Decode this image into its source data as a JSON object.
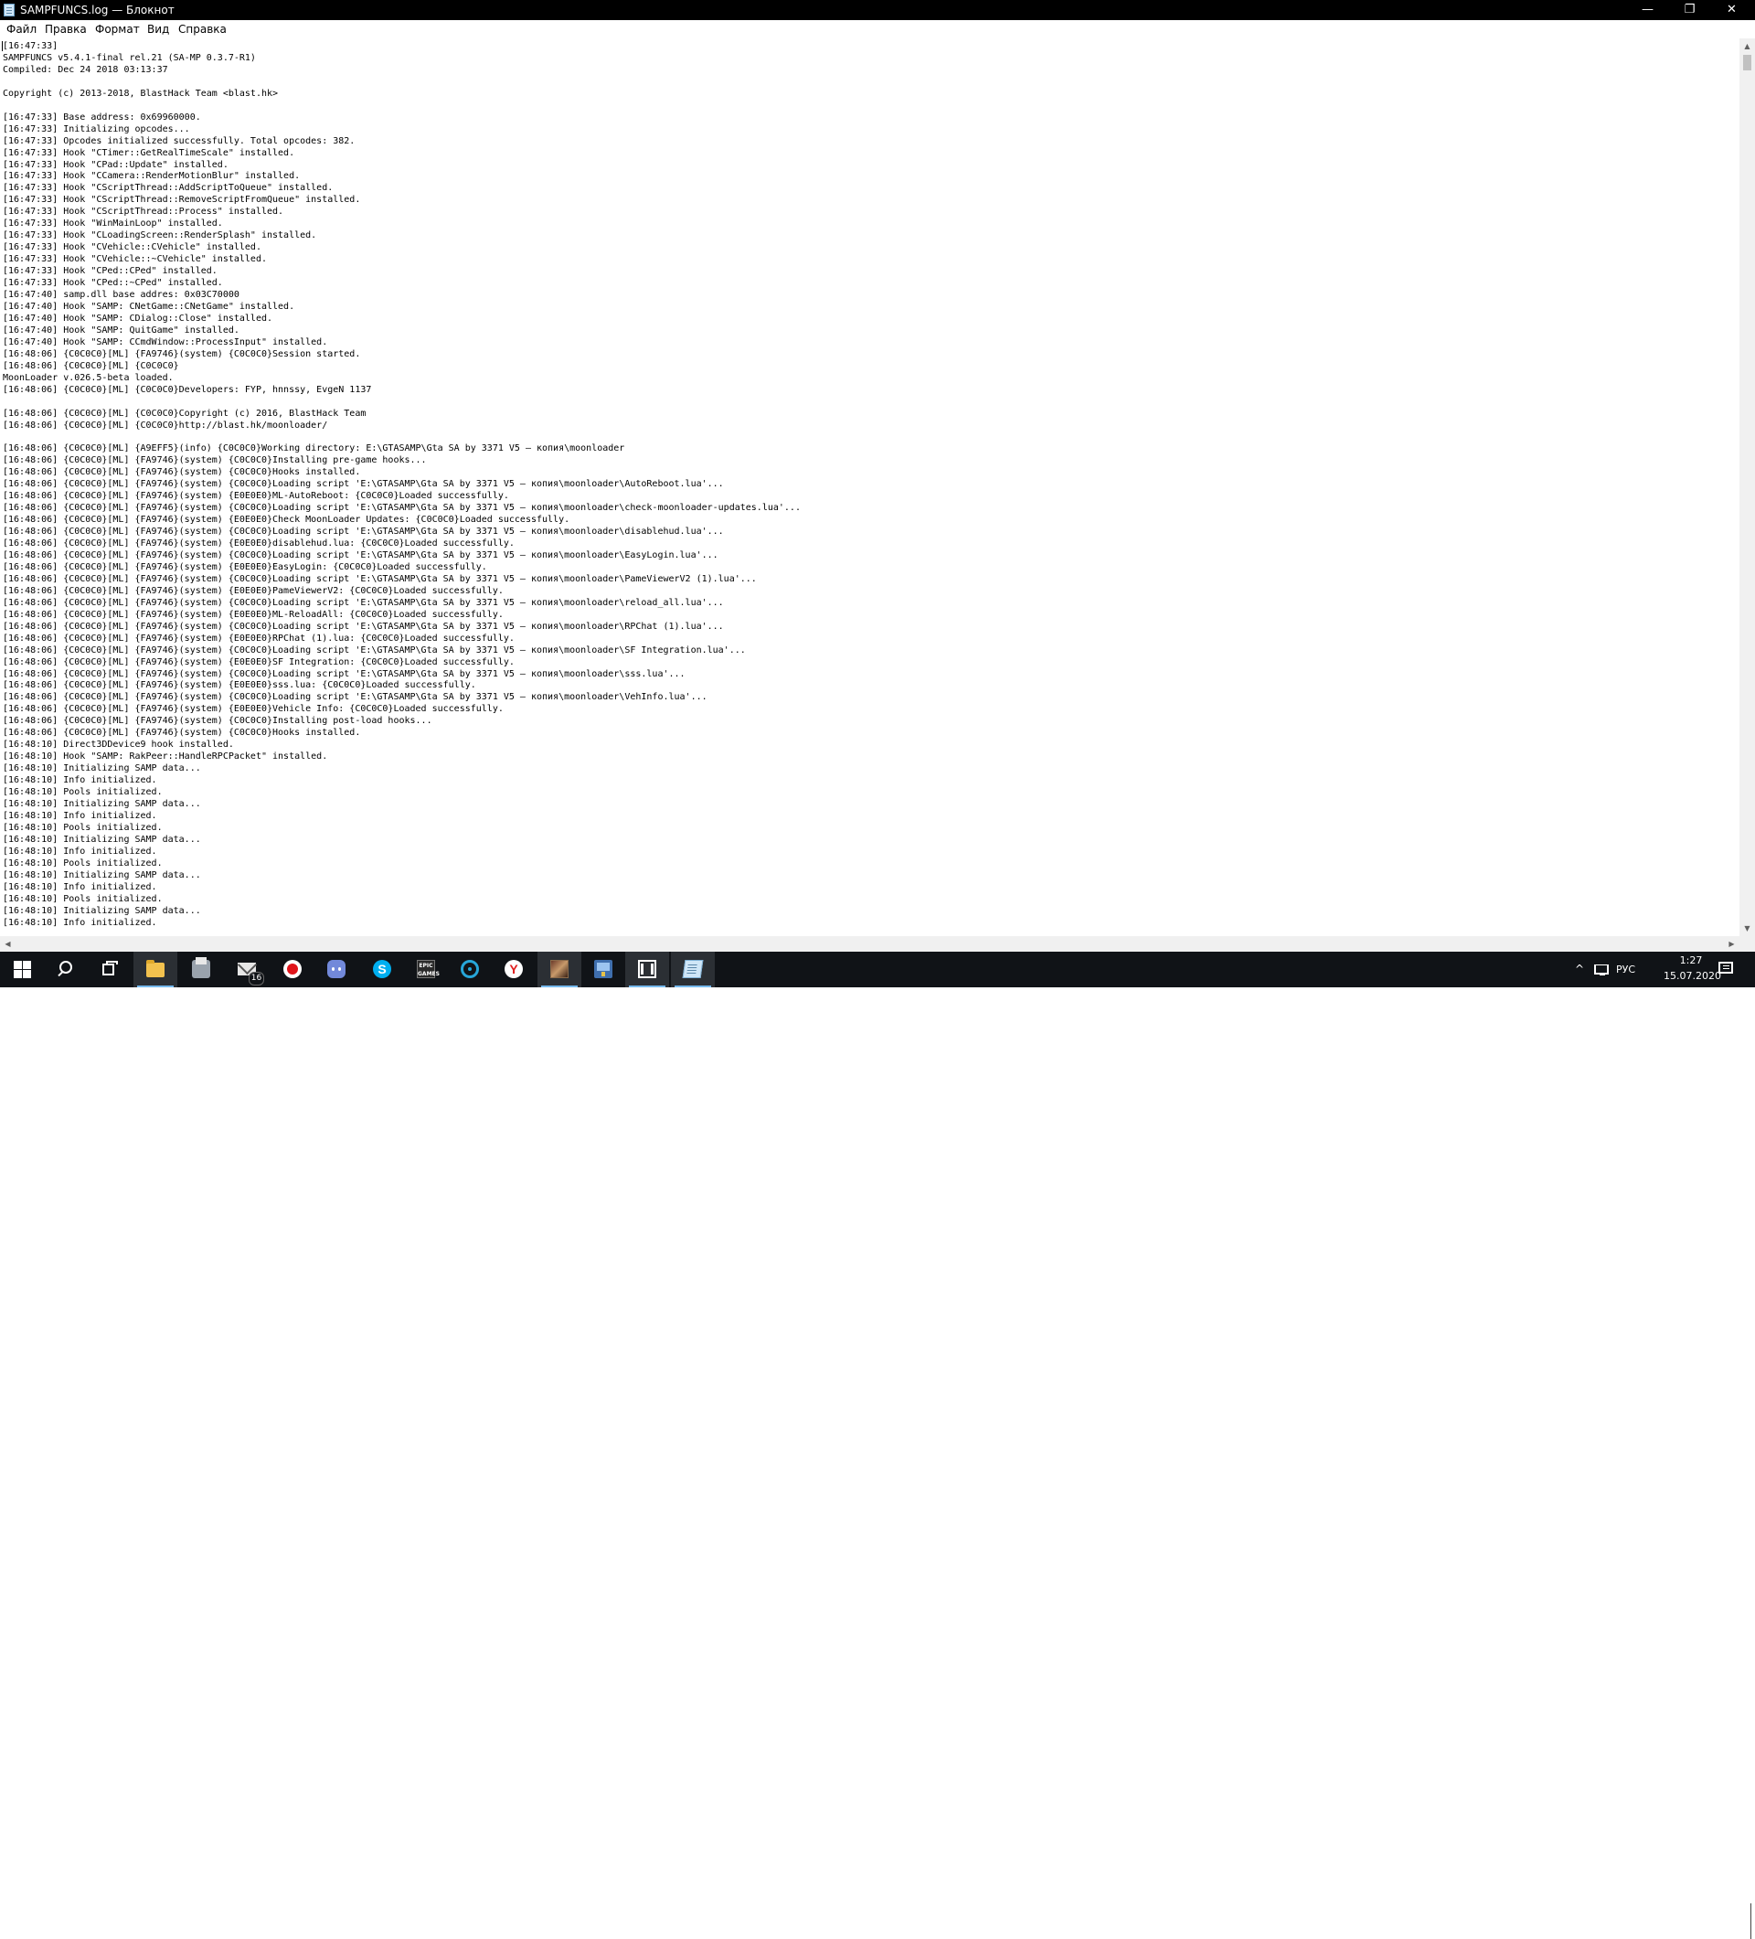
{
  "window": {
    "title": "SAMPFUNCS.log — Блокнот",
    "min_glyph": "—",
    "max_glyph": "❐",
    "close_glyph": "✕"
  },
  "menu": {
    "file": "Файл",
    "edit": "Правка",
    "format": "Формат",
    "view": "Вид",
    "help": "Справка"
  },
  "scrollbar": {
    "up": "▲",
    "down": "▼",
    "left": "◀",
    "right": "▶"
  },
  "log_text": "[16:47:33]\nSAMPFUNCS v5.4.1-final rel.21 (SA-MP 0.3.7-R1)\nCompiled: Dec 24 2018 03:13:37\n\nCopyright (c) 2013-2018, BlastHack Team <blast.hk>\n\n[16:47:33] Base address: 0x69960000.\n[16:47:33] Initializing opcodes...\n[16:47:33] Opcodes initialized successfully. Total opcodes: 382.\n[16:47:33] Hook \"CTimer::GetRealTimeScale\" installed.\n[16:47:33] Hook \"CPad::Update\" installed.\n[16:47:33] Hook \"CCamera::RenderMotionBlur\" installed.\n[16:47:33] Hook \"CScriptThread::AddScriptToQueue\" installed.\n[16:47:33] Hook \"CScriptThread::RemoveScriptFromQueue\" installed.\n[16:47:33] Hook \"CScriptThread::Process\" installed.\n[16:47:33] Hook \"WinMainLoop\" installed.\n[16:47:33] Hook \"CLoadingScreen::RenderSplash\" installed.\n[16:47:33] Hook \"CVehicle::CVehicle\" installed.\n[16:47:33] Hook \"CVehicle::~CVehicle\" installed.\n[16:47:33] Hook \"CPed::CPed\" installed.\n[16:47:33] Hook \"CPed::~CPed\" installed.\n[16:47:40] samp.dll base addres: 0x03C70000\n[16:47:40] Hook \"SAMP: CNetGame::CNetGame\" installed.\n[16:47:40] Hook \"SAMP: CDialog::Close\" installed.\n[16:47:40] Hook \"SAMP: QuitGame\" installed.\n[16:47:40] Hook \"SAMP: CCmdWindow::ProcessInput\" installed.\n[16:48:06] {C0C0C0}[ML] {FA9746}(system) {C0C0C0}Session started.\n[16:48:06] {C0C0C0}[ML] {C0C0C0}\nMoonLoader v.026.5-beta loaded.\n[16:48:06] {C0C0C0}[ML] {C0C0C0}Developers: FYP, hnnssy, EvgeN 1137\n\n[16:48:06] {C0C0C0}[ML] {C0C0C0}Copyright (c) 2016, BlastHack Team\n[16:48:06] {C0C0C0}[ML] {C0C0C0}http://blast.hk/moonloader/\n\n[16:48:06] {C0C0C0}[ML] {A9EFF5}(info) {C0C0C0}Working directory: E:\\GTASAMP\\Gta SA by 3371 V5 — копия\\moonloader\n[16:48:06] {C0C0C0}[ML] {FA9746}(system) {C0C0C0}Installing pre-game hooks...\n[16:48:06] {C0C0C0}[ML] {FA9746}(system) {C0C0C0}Hooks installed.\n[16:48:06] {C0C0C0}[ML] {FA9746}(system) {C0C0C0}Loading script 'E:\\GTASAMP\\Gta SA by 3371 V5 — копия\\moonloader\\AutoReboot.lua'...\n[16:48:06] {C0C0C0}[ML] {FA9746}(system) {E0E0E0}ML-AutoReboot: {C0C0C0}Loaded successfully.\n[16:48:06] {C0C0C0}[ML] {FA9746}(system) {C0C0C0}Loading script 'E:\\GTASAMP\\Gta SA by 3371 V5 — копия\\moonloader\\check-moonloader-updates.lua'...\n[16:48:06] {C0C0C0}[ML] {FA9746}(system) {E0E0E0}Check MoonLoader Updates: {C0C0C0}Loaded successfully.\n[16:48:06] {C0C0C0}[ML] {FA9746}(system) {C0C0C0}Loading script 'E:\\GTASAMP\\Gta SA by 3371 V5 — копия\\moonloader\\disablehud.lua'...\n[16:48:06] {C0C0C0}[ML] {FA9746}(system) {E0E0E0}disablehud.lua: {C0C0C0}Loaded successfully.\n[16:48:06] {C0C0C0}[ML] {FA9746}(system) {C0C0C0}Loading script 'E:\\GTASAMP\\Gta SA by 3371 V5 — копия\\moonloader\\EasyLogin.lua'...\n[16:48:06] {C0C0C0}[ML] {FA9746}(system) {E0E0E0}EasyLogin: {C0C0C0}Loaded successfully.\n[16:48:06] {C0C0C0}[ML] {FA9746}(system) {C0C0C0}Loading script 'E:\\GTASAMP\\Gta SA by 3371 V5 — копия\\moonloader\\PameViewerV2 (1).lua'...\n[16:48:06] {C0C0C0}[ML] {FA9746}(system) {E0E0E0}PameViewerV2: {C0C0C0}Loaded successfully.\n[16:48:06] {C0C0C0}[ML] {FA9746}(system) {C0C0C0}Loading script 'E:\\GTASAMP\\Gta SA by 3371 V5 — копия\\moonloader\\reload_all.lua'...\n[16:48:06] {C0C0C0}[ML] {FA9746}(system) {E0E0E0}ML-ReloadAll: {C0C0C0}Loaded successfully.\n[16:48:06] {C0C0C0}[ML] {FA9746}(system) {C0C0C0}Loading script 'E:\\GTASAMP\\Gta SA by 3371 V5 — копия\\moonloader\\RPChat (1).lua'...\n[16:48:06] {C0C0C0}[ML] {FA9746}(system) {E0E0E0}RPChat (1).lua: {C0C0C0}Loaded successfully.\n[16:48:06] {C0C0C0}[ML] {FA9746}(system) {C0C0C0}Loading script 'E:\\GTASAMP\\Gta SA by 3371 V5 — копия\\moonloader\\SF Integration.lua'...\n[16:48:06] {C0C0C0}[ML] {FA9746}(system) {E0E0E0}SF Integration: {C0C0C0}Loaded successfully.\n[16:48:06] {C0C0C0}[ML] {FA9746}(system) {C0C0C0}Loading script 'E:\\GTASAMP\\Gta SA by 3371 V5 — копия\\moonloader\\sss.lua'...\n[16:48:06] {C0C0C0}[ML] {FA9746}(system) {E0E0E0}sss.lua: {C0C0C0}Loaded successfully.\n[16:48:06] {C0C0C0}[ML] {FA9746}(system) {C0C0C0}Loading script 'E:\\GTASAMP\\Gta SA by 3371 V5 — копия\\moonloader\\VehInfo.lua'...\n[16:48:06] {C0C0C0}[ML] {FA9746}(system) {E0E0E0}Vehicle Info: {C0C0C0}Loaded successfully.\n[16:48:06] {C0C0C0}[ML] {FA9746}(system) {C0C0C0}Installing post-load hooks...\n[16:48:06] {C0C0C0}[ML] {FA9746}(system) {C0C0C0}Hooks installed.\n[16:48:10] Direct3DDevice9 hook installed.\n[16:48:10] Hook \"SAMP: RakPeer::HandleRPCPacket\" installed.\n[16:48:10] Initializing SAMP data...\n[16:48:10] Info initialized.\n[16:48:10] Pools initialized.\n[16:48:10] Initializing SAMP data...\n[16:48:10] Info initialized.\n[16:48:10] Pools initialized.\n[16:48:10] Initializing SAMP data...\n[16:48:10] Info initialized.\n[16:48:10] Pools initialized.\n[16:48:10] Initializing SAMP data...\n[16:48:10] Info initialized.\n[16:48:10] Pools initialized.\n[16:48:10] Initializing SAMP data...\n[16:48:10] Info initialized.",
  "taskbar": {
    "mail_badge": "16",
    "epic_label": "EPIC GAMES",
    "skype_letter": "S",
    "yandex_letter": "Y",
    "tray_chevron": "^",
    "language": "РУС",
    "time": "1:27",
    "date": "15.07.2020",
    "indicator_color": "#76b9ed"
  }
}
